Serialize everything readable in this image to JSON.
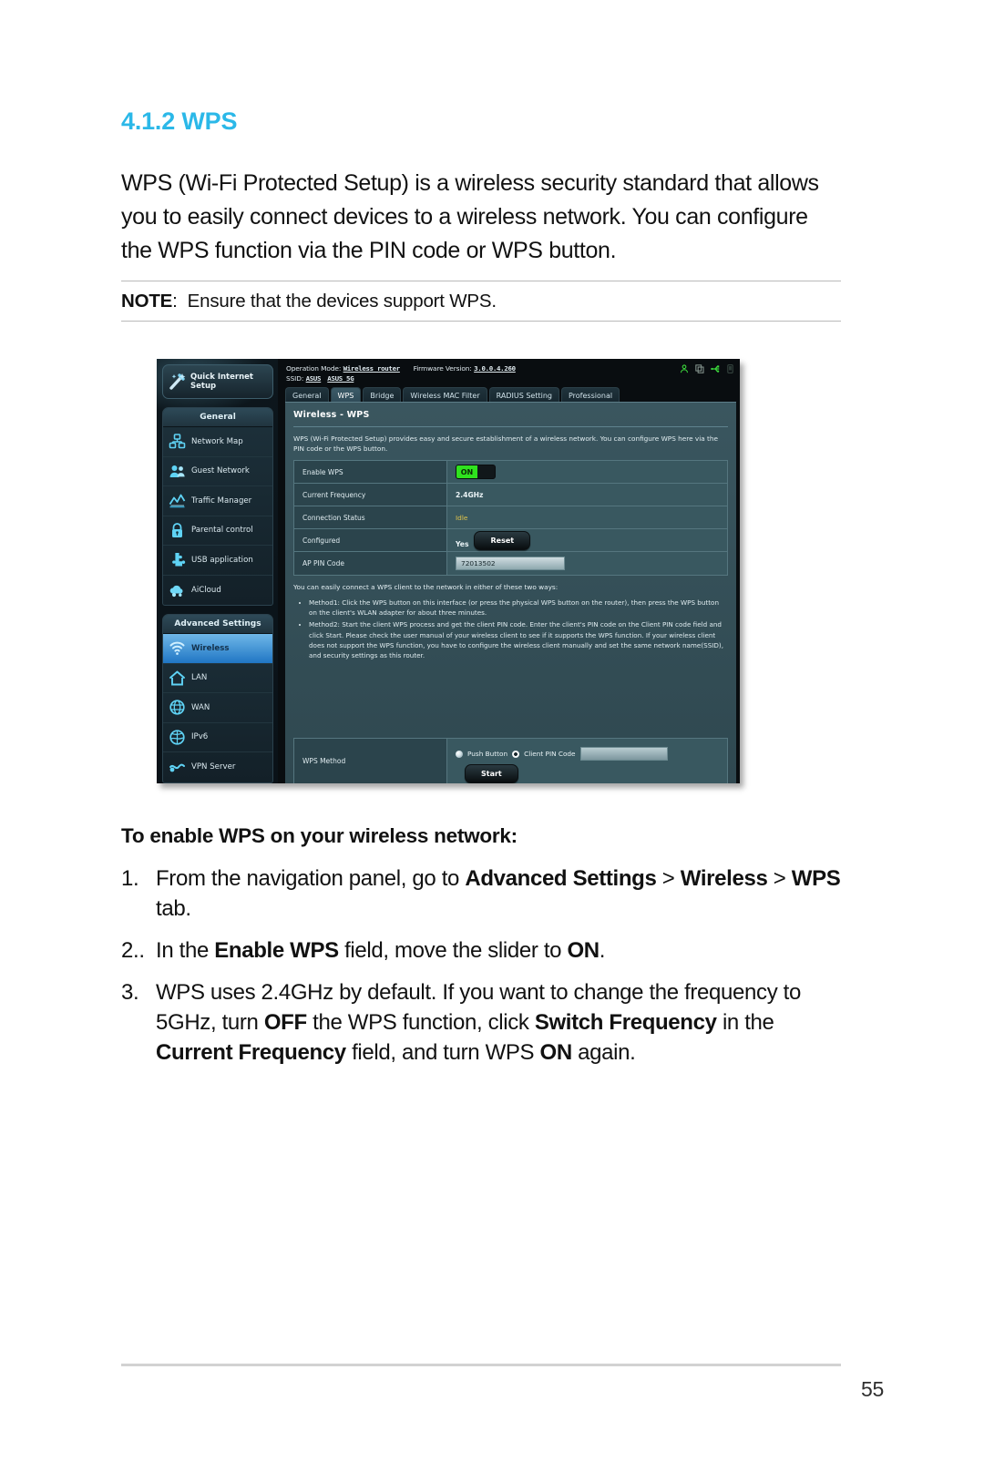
{
  "document": {
    "section_number": "4.1.2",
    "section_title": "WPS",
    "heading": "4.1.2 WPS",
    "intro": "WPS (Wi-Fi Protected Setup) is a wireless security standard that allows you to easily connect devices to a wireless network. You can configure the WPS function via the PIN code or WPS button.",
    "note_label": "NOTE",
    "note_text": "Ensure that the devices support WPS.",
    "page_number": "55"
  },
  "instructions": {
    "heading": "To enable WPS on your wireless network:",
    "steps": [
      {
        "num": "1.",
        "html": "From the navigation panel, go to <b>Advanced Settings</b> &gt; <b>Wireless</b> &gt; <b>WPS</b> tab."
      },
      {
        "num": "2..",
        "html": "In the <b>Enable WPS</b> field, move the slider to <b>ON</b>."
      },
      {
        "num": "3.",
        "html": "WPS uses 2.4GHz by default. If you want to change the frequency to 5GHz, turn <b>OFF</b> the WPS function, click <b>Switch Frequency</b> in the <b>Current Frequency</b> field, and turn WPS <b>ON</b> again."
      }
    ]
  },
  "router_ui": {
    "quick_setup": {
      "label": "Quick Internet Setup",
      "icon": "wand-icon"
    },
    "nav_groups": [
      {
        "title": "General",
        "items": [
          {
            "label": "Network Map",
            "icon": "network-map-icon",
            "active": false
          },
          {
            "label": "Guest Network",
            "icon": "guest-network-icon",
            "active": false
          },
          {
            "label": "Traffic Manager",
            "icon": "traffic-manager-icon",
            "active": false
          },
          {
            "label": "Parental control",
            "icon": "lock-icon",
            "active": false
          },
          {
            "label": "USB application",
            "icon": "usb-application-icon",
            "active": false
          },
          {
            "label": "AiCloud",
            "icon": "cloud-icon",
            "active": false
          }
        ]
      },
      {
        "title": "Advanced Settings",
        "items": [
          {
            "label": "Wireless",
            "icon": "wifi-icon",
            "active": true
          },
          {
            "label": "LAN",
            "icon": "home-icon",
            "active": false
          },
          {
            "label": "WAN",
            "icon": "globe-icon",
            "active": false
          },
          {
            "label": "IPv6",
            "icon": "ipv6-globe-icon",
            "active": false
          },
          {
            "label": "VPN Server",
            "icon": "vpn-icon",
            "active": false
          }
        ]
      }
    ],
    "header": {
      "operation_mode_label": "Operation Mode:",
      "operation_mode_value": "Wireless router",
      "firmware_label": "Firmware Version:",
      "firmware_value": "3.0.0.4.260",
      "ssid_label": "SSID:",
      "ssid_values": [
        "ASUS",
        "ASUS_5G"
      ],
      "system_icons": [
        "user-icon",
        "copy-icon",
        "usb-icon",
        "phone-icon"
      ]
    },
    "tabs": [
      {
        "label": "General",
        "active": false
      },
      {
        "label": "WPS",
        "active": true
      },
      {
        "label": "Bridge",
        "active": false
      },
      {
        "label": "Wireless MAC Filter",
        "active": false
      },
      {
        "label": "RADIUS Setting",
        "active": false
      },
      {
        "label": "Professional",
        "active": false
      }
    ],
    "panel": {
      "title": "Wireless - WPS",
      "description": "WPS (Wi-Fi Protected Setup) provides easy and secure establishment of a wireless network. You can configure WPS here via the PIN code or the WPS button.",
      "fields": [
        {
          "name": "Enable WPS",
          "type": "toggle",
          "value": "ON"
        },
        {
          "name": "Current Frequency",
          "type": "text",
          "value": "2.4GHz"
        },
        {
          "name": "Connection Status",
          "type": "status",
          "value": "Idle"
        },
        {
          "name": "Configured",
          "type": "text-button",
          "value": "Yes",
          "button": "Reset"
        },
        {
          "name": "AP PIN Code",
          "type": "input",
          "value": "72013502"
        }
      ],
      "howto_intro": "You can easily connect a WPS client to the network in either of these two ways:",
      "methods": [
        "Method1: Click the WPS button on this interface (or press the physical WPS button on the router), then press the WPS button on the client's WLAN adapter for about three minutes.",
        "Method2: Start the client WPS process and get the client PIN code. Enter the client's PIN code on the Client PIN code field and click Start. Please check the user manual of your wireless client to see if it supports the WPS function. If your wireless client does not support the WPS function, you have to configure the wireless client manually and set the same network name(SSID), and security settings as this router."
      ],
      "wps_method": {
        "name": "WPS Method",
        "options": [
          {
            "label": "Push Button",
            "selected": false
          },
          {
            "label": "Client PIN Code",
            "selected": true
          }
        ],
        "pin_input_value": "",
        "start_button": "Start"
      }
    }
  },
  "colors": {
    "heading": "#2bb8e8",
    "toggle_on": "#2fe21e",
    "status_idle": "#e0c44a",
    "nav_active": "#2076c4",
    "panel_bg": "#345059"
  }
}
